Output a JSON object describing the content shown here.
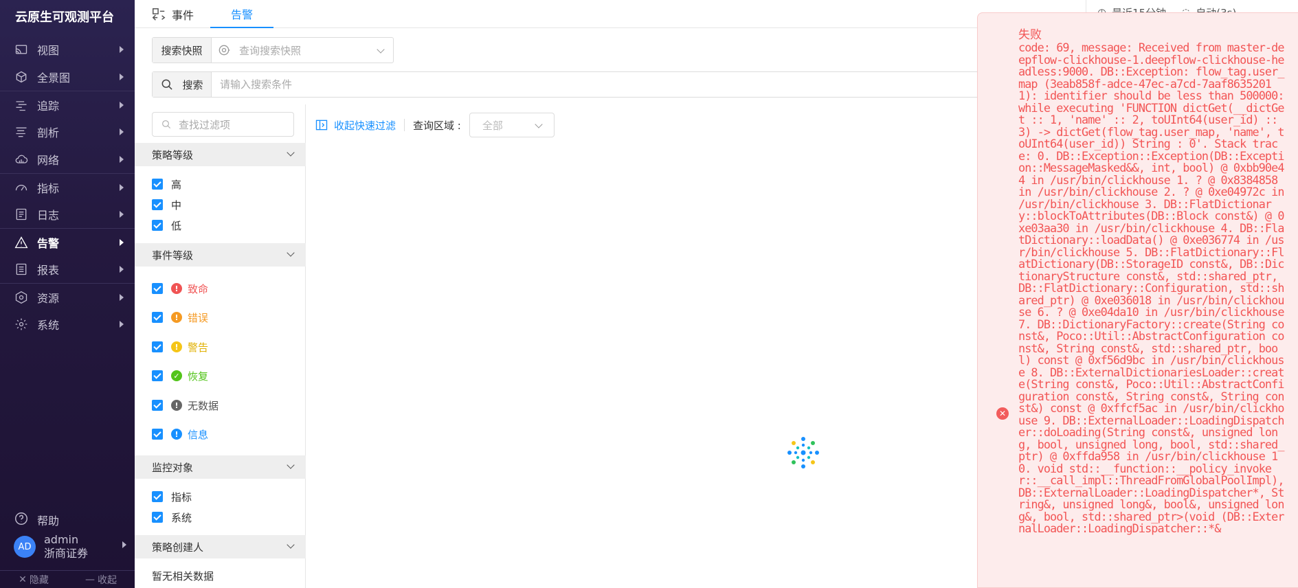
{
  "brand": "云原生可观测平台",
  "nav": [
    {
      "label": "视图"
    },
    {
      "label": "全景图"
    },
    {
      "label": "追踪"
    },
    {
      "label": "剖析"
    },
    {
      "label": "网络"
    },
    {
      "label": "指标"
    },
    {
      "label": "日志"
    },
    {
      "label": "告警"
    },
    {
      "label": "报表"
    },
    {
      "label": "资源"
    },
    {
      "label": "系统"
    }
  ],
  "help": "帮助",
  "user": {
    "avatar": "AD",
    "name": "admin",
    "org": "浙商证券"
  },
  "sidebar_bottom": {
    "hide": "隐藏",
    "collapse": "收起"
  },
  "tabs": {
    "events": "事件",
    "alerts": "告警"
  },
  "top_right": {
    "time_range": "最近15分钟",
    "auto_refresh": "自动(3s)"
  },
  "snapshot": {
    "label": "搜索快照",
    "placeholder": "查询搜索快照"
  },
  "search": {
    "button": "搜索",
    "placeholder": "请输入搜索条件"
  },
  "filter": {
    "search_placeholder": "查找过滤项",
    "policy_level": {
      "title": "策略等级",
      "options": [
        "高",
        "中",
        "低"
      ]
    },
    "event_level": {
      "title": "事件等级",
      "options": [
        "致命",
        "错误",
        "警告",
        "恢复",
        "无数据",
        "信息"
      ]
    },
    "monitor_target": {
      "title": "监控对象",
      "options": [
        "指标",
        "系统"
      ]
    },
    "policy_creator": {
      "title": "策略创建人",
      "empty": "暂无相关数据"
    }
  },
  "toolbar": {
    "collapse_filter": "收起快速过滤",
    "region_label": "查询区域 :",
    "region_value": "全部"
  },
  "colors": {
    "accent": "#1890ff",
    "fatal": "#f05454",
    "error": "#f59a23",
    "warning": "#f5c518",
    "recover": "#52c41a",
    "nodata": "#666666",
    "info": "#1890ff",
    "toast_text": "#f25555"
  },
  "toast": {
    "title": "失败",
    "message": "code: 69, message: Received from master-deepflow-clickhouse-1.deepflow-clickhouse-headless:9000. DB::Exception: flow_tag.user_map (3eab858f-adce-47ec-a7cd-7aaf86352011): identifier should be less than 500000: while executing 'FUNCTION dictGet(__dictGet :: 1, 'name' :: 2, toUInt64(user_id) :: 3) -> dictGet(flow_tag.user_map, 'name', toUInt64(user_id)) String : 0'. Stack trace: 0. DB::Exception::Exception(DB::Exception::MessageMasked&&, int, bool) @ 0xbb90e44 in /usr/bin/clickhouse 1. ? @ 0x8384858 in /usr/bin/clickhouse 2. ? @ 0xe04972c in /usr/bin/clickhouse 3. DB::FlatDictionary::blockToAttributes(DB::Block const&) @ 0xe03aa30 in /usr/bin/clickhouse 4. DB::FlatDictionary::loadData() @ 0xe036774 in /usr/bin/clickhouse 5. DB::FlatDictionary::FlatDictionary(DB::StorageID const&, DB::DictionaryStructure const&, std::shared_ptr, DB::FlatDictionary::Configuration, std::shared_ptr) @ 0xe036018 in /usr/bin/clickhouse 6. ? @ 0xe04da10 in /usr/bin/clickhouse 7. DB::DictionaryFactory::create(String const&, Poco::Util::AbstractConfiguration const&, String const&, std::shared_ptr, bool) const @ 0xf56d9bc in /usr/bin/clickhouse 8. DB::ExternalDictionariesLoader::create(String const&, Poco::Util::AbstractConfiguration const&, String const&, String const&) const @ 0xffcf5ac in /usr/bin/clickhouse 9. DB::ExternalLoader::LoadingDispatcher::doLoading(String const&, unsigned long, bool, unsigned long, bool, std::shared_ptr) @ 0xffda958 in /usr/bin/clickhouse 10. void std::__function::__policy_invoker::__call_impl::ThreadFromGlobalPoolImpl), DB::ExternalLoader::LoadingDispatcher*, String&, unsigned long&, bool&, unsigned long&, bool, std::shared_ptr>(void (DB::ExternalLoader::LoadingDispatcher::*&"
  }
}
